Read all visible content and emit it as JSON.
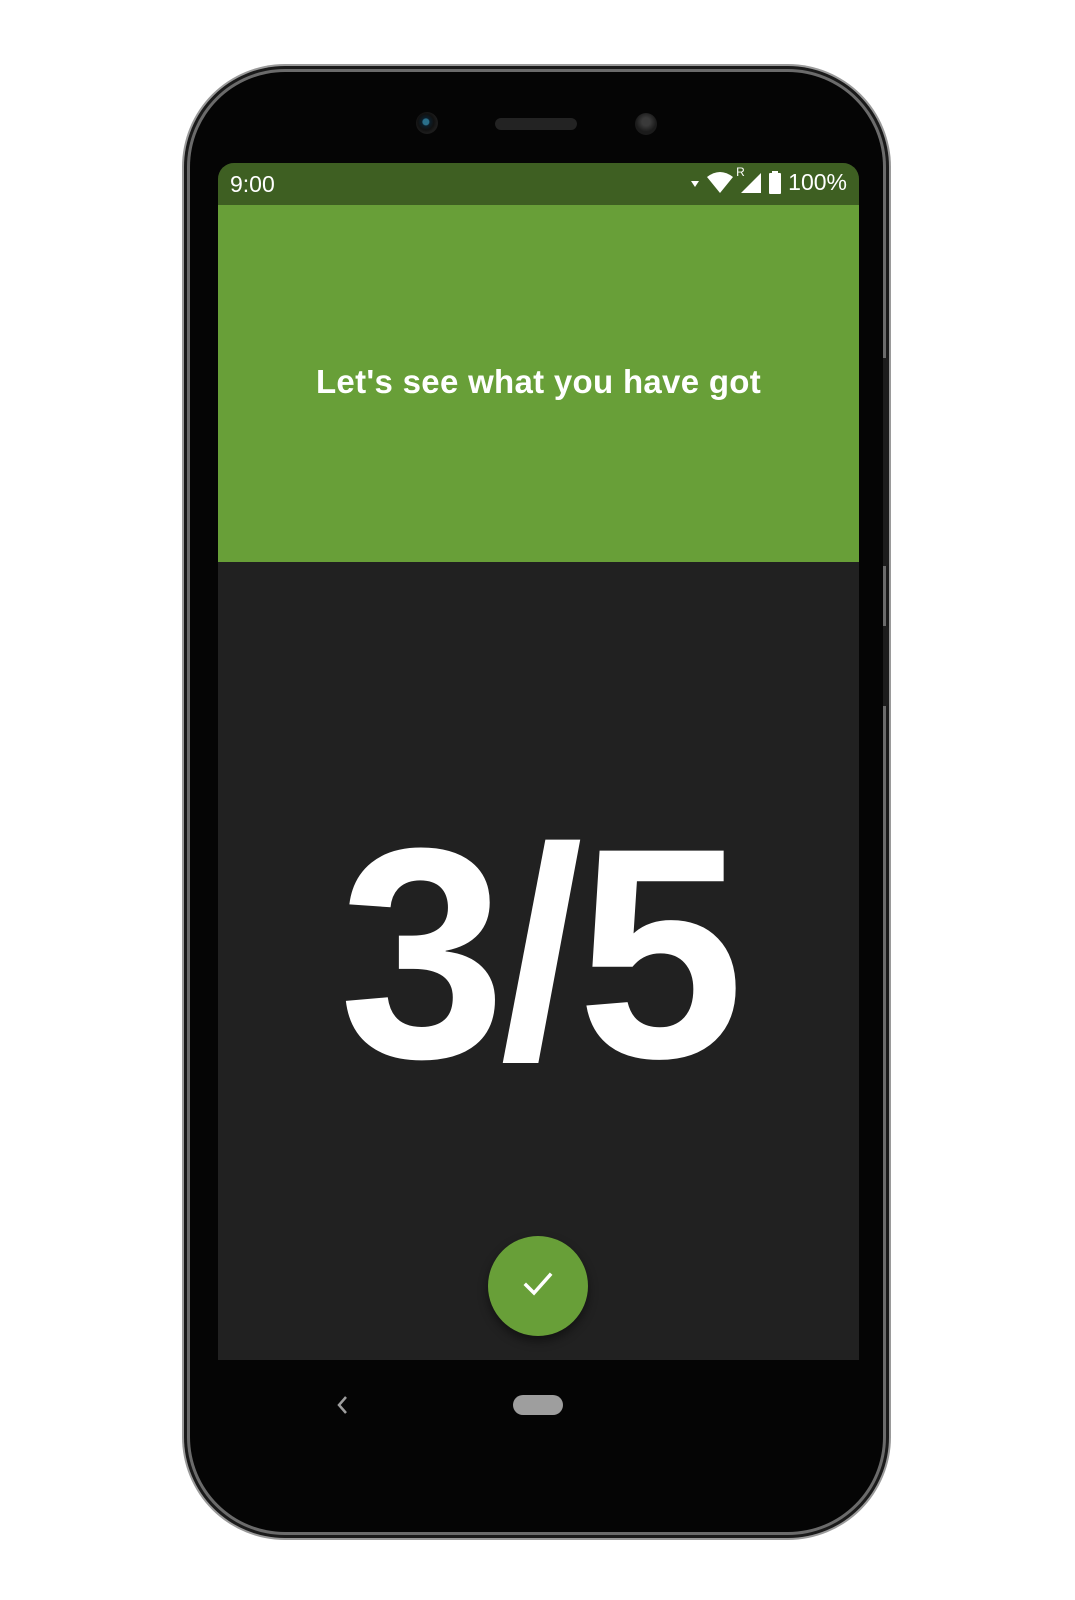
{
  "status_bar": {
    "time": "9:00",
    "network_indicator": "R",
    "battery_percent": "100%",
    "icons": [
      "data-activity-icon",
      "wifi-icon",
      "cell-signal-icon",
      "battery-icon"
    ]
  },
  "header": {
    "title": "Let's see what you have got"
  },
  "result": {
    "score_text": "3/5"
  },
  "fab": {
    "icon": "check-icon"
  },
  "navigation": {
    "icons": [
      "back-icon",
      "home-pill"
    ]
  },
  "colors": {
    "primary": "#689f38",
    "status_bar": "#3e5f22",
    "background": "#212121",
    "text": "#ffffff"
  }
}
